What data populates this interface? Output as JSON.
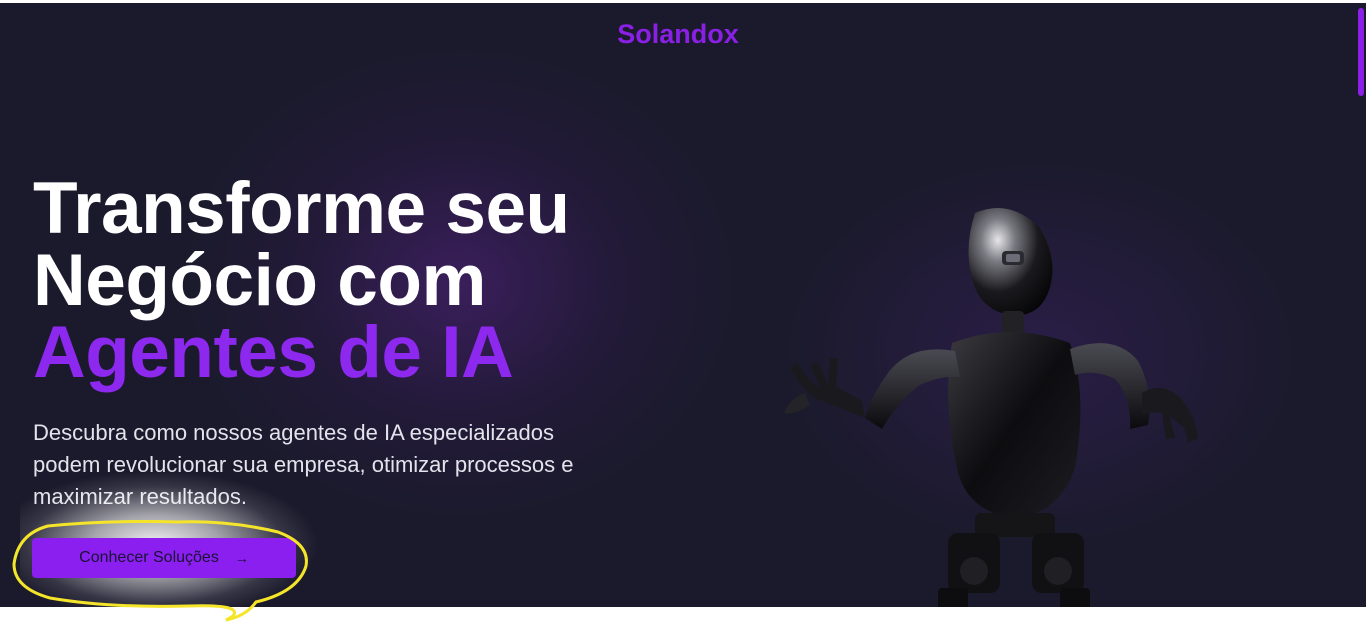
{
  "header": {
    "brand": "Solandox"
  },
  "hero": {
    "headline_line1": "Transforme seu",
    "headline_line2": "Negócio com",
    "headline_accent": "Agentes de IA",
    "subtitle": "Descubra como nossos agentes de IA especializados podem revolucionar sua empresa, otimizar processos e maximizar resultados.",
    "cta_label": "Conhecer Soluções",
    "cta_icon": "arrow-right-icon",
    "illustration": "robot-image"
  },
  "colors": {
    "background": "#1b1a2c",
    "accent": "#8a1fe6",
    "button": "#8a1ff0",
    "annotation": "#f5e52a"
  }
}
